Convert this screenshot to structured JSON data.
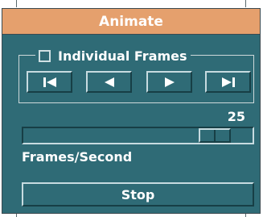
{
  "window": {
    "title": "Animate"
  },
  "frames_group": {
    "checkbox_label": "Individual Frames",
    "checked": false
  },
  "nav_buttons": [
    {
      "name": "first-frame-button",
      "icon": "skip-to-start-icon"
    },
    {
      "name": "previous-frame-button",
      "icon": "play-reverse-icon"
    },
    {
      "name": "next-frame-button",
      "icon": "play-forward-icon"
    },
    {
      "name": "last-frame-button",
      "icon": "skip-to-end-icon"
    }
  ],
  "rate": {
    "value": "25",
    "label": "Frames/Second",
    "level": 0.89
  },
  "actions": {
    "stop_label": "Stop"
  },
  "colors": {
    "title_bar": "#e5a06d",
    "panel": "#2f6b76",
    "text": "#ffffff"
  }
}
